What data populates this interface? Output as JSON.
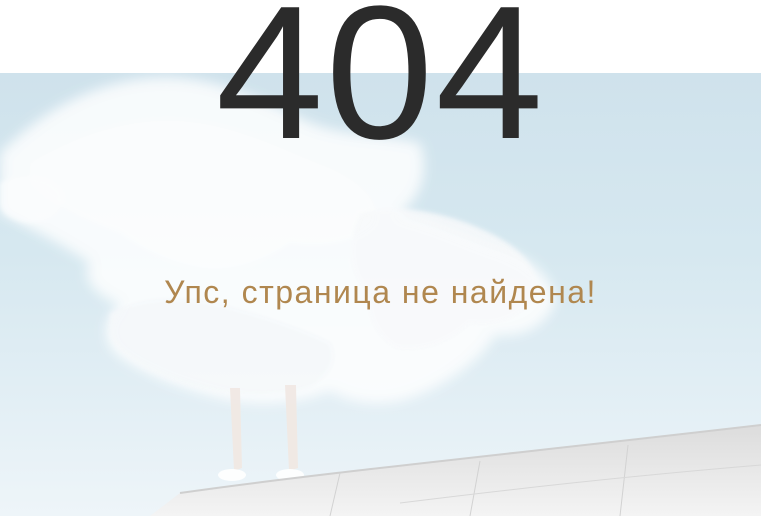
{
  "error": {
    "code": "404",
    "message": "Упс, страница не найдена!"
  },
  "colors": {
    "code": "#2b2b2b",
    "message": "#b0874f",
    "sky": "#d6e8f0"
  },
  "hero": {
    "illustration": "person-in-flowing-white-fabric-on-ledge"
  }
}
